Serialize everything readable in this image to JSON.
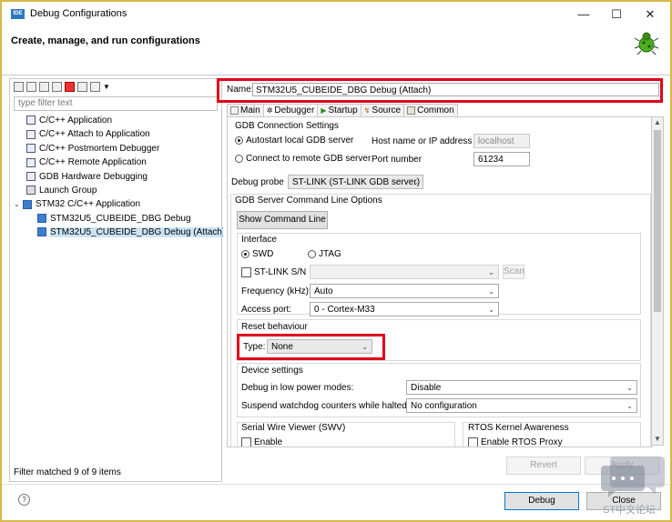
{
  "window": {
    "logo_text": "IDE",
    "title": "Debug Configurations",
    "minimize_glyph": "—",
    "maximize_glyph": "☐",
    "close_glyph": "✕"
  },
  "header": {
    "title": "Create, manage, and run configurations",
    "icon": "bug-icon"
  },
  "left": {
    "filter_placeholder": "type filter text",
    "tree": [
      {
        "label": "C/C++ Application",
        "level": 1
      },
      {
        "label": "C/C++ Attach to Application",
        "level": 1
      },
      {
        "label": "C/C++ Postmortem Debugger",
        "level": 1
      },
      {
        "label": "C/C++ Remote Application",
        "level": 1
      },
      {
        "label": "GDB Hardware Debugging",
        "level": 1
      },
      {
        "label": "Launch Group",
        "level": 1
      },
      {
        "label": "STM32 C/C++ Application",
        "level": 1,
        "expanded": true
      },
      {
        "label": "STM32U5_CUBEIDE_DBG Debug",
        "level": 2
      },
      {
        "label": "STM32U5_CUBEIDE_DBG Debug (Attach)",
        "level": 2,
        "selected": true
      }
    ],
    "status": "Filter matched 9 of 9 items"
  },
  "right": {
    "name_label": "Name:",
    "name_value": "STM32U5_CUBEIDE_DBG Debug (Attach)",
    "tabs": [
      {
        "label": "Main",
        "active": false
      },
      {
        "label": "Debugger",
        "active": true
      },
      {
        "label": "Startup",
        "active": false
      },
      {
        "label": "Source",
        "active": false
      },
      {
        "label": "Common",
        "active": false
      }
    ]
  },
  "debugger": {
    "gdb_group_title": "GDB Connection Settings",
    "autostart_label": "Autostart local GDB server",
    "remote_label": "Connect to remote GDB server",
    "host_label": "Host name or IP address",
    "host_value": "localhost",
    "port_label": "Port number",
    "port_value": "61234",
    "probe_label": "Debug probe",
    "probe_value": "ST-LINK (ST-LINK GDB server)",
    "server_group_title": "GDB Server Command Line Options",
    "show_cmd_label": "Show Command Line",
    "interface_title": "Interface",
    "swd_label": "SWD",
    "jtag_label": "JTAG",
    "stlink_sn_label": "ST-LINK S/N",
    "scan_label": "Scan",
    "freq_label": "Frequency (kHz):",
    "freq_value": "Auto",
    "access_label": "Access port:",
    "access_value": "0 - Cortex-M33",
    "reset_title": "Reset behaviour",
    "type_label": "Type:",
    "type_value": "None",
    "device_title": "Device settings",
    "lowpower_label": "Debug in low power modes:",
    "lowpower_value": "Disable",
    "watchdog_label": "Suspend watchdog counters while halted:",
    "watchdog_value": "No configuration",
    "swv_title": "Serial Wire Viewer (SWV)",
    "swv_enable": "Enable",
    "rtos_title": "RTOS Kernel Awareness",
    "rtos_enable": "Enable RTOS Proxy"
  },
  "buttons": {
    "revert": "Revert",
    "apply": "Apply",
    "debug": "Debug",
    "close": "Close",
    "help_glyph": "?"
  },
  "watermark": {
    "text": "ST中文论坛"
  },
  "colors": {
    "highlight": "#e0001b",
    "selection": "#cce4f7",
    "frame": "#d4b84c"
  }
}
